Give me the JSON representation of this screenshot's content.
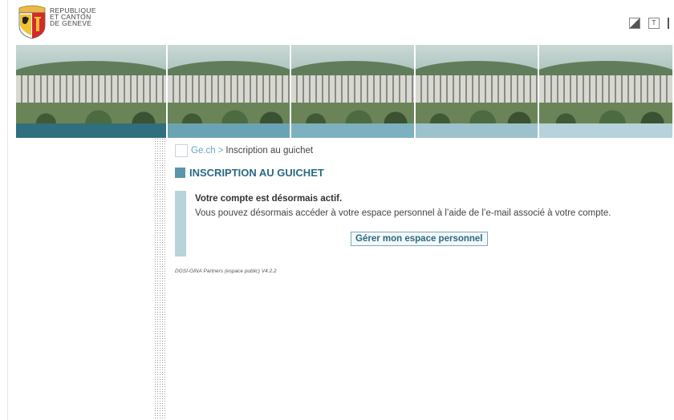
{
  "header": {
    "logo_lines": [
      "REPUBLIQUE",
      "ET CANTON",
      "DE GENEVE"
    ],
    "icons": [
      "contrast-icon",
      "text-size-icon",
      "menu-icon"
    ]
  },
  "banner": {
    "strip_colors": [
      "#2f6f7e",
      "#6aa3b3",
      "#7db1bf",
      "#9cc2cd",
      "#b6d2da"
    ]
  },
  "breadcrumb": {
    "home_label": "Ge.ch",
    "separator": ">",
    "current": "Inscription au guichet"
  },
  "page": {
    "title": "INSCRIPTION AU GUICHET"
  },
  "message": {
    "heading": "Votre compte est désormais actif.",
    "body": "Vous pouvez désormais accéder à votre espace personnel à l’aide de l’e-mail associé à votre compte.",
    "button_label": "Gérer mon espace personnel"
  },
  "footer": {
    "version": "DGSI-GINA Partners (espace public) V4.2.2"
  },
  "colors": {
    "accent": "#2a6a82",
    "link": "#6aa5c0"
  }
}
